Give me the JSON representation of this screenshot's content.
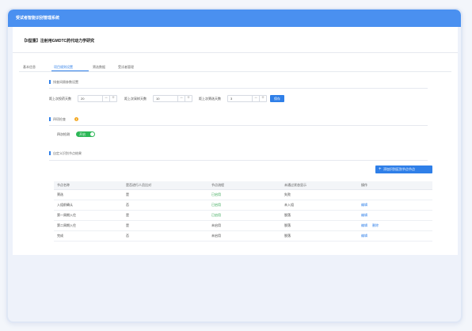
{
  "app": {
    "title": "受试者智能识别管理系统"
  },
  "project": {
    "title": "【II型重】注射用GMDTC药代动力学研究"
  },
  "tabs": [
    {
      "label": "基本信息",
      "active": false
    },
    {
      "label": "项目规则设置",
      "active": true
    },
    {
      "label": "筛选数据",
      "active": false
    },
    {
      "label": "受试者管理",
      "active": false
    }
  ],
  "sections": {
    "interval": {
      "title": "排查间隔参数设置",
      "fields": [
        {
          "label": "距上次投药天数",
          "value": "20"
        },
        {
          "label": "距上次采样天数",
          "value": "10"
        },
        {
          "label": "距上次筛选天数",
          "value": "3"
        }
      ],
      "save_label": "保存"
    },
    "check": {
      "title": "四项检查",
      "field_label": "四次检测",
      "toggle_label": "开启",
      "toggle_on": true
    },
    "flow": {
      "title": "自定义识别节点结果",
      "add_label": "添加识别区别节点节点"
    }
  },
  "table": {
    "headers": [
      "节点名称",
      "是否进行人员比对",
      "节点流程",
      "未通过状态显示",
      "操作"
    ],
    "rows": [
      {
        "name": "筛选",
        "compare": "是",
        "status": "已启用",
        "status_done": true,
        "fail": "失败",
        "actions": []
      },
      {
        "name": "入组前确认",
        "compare": "否",
        "status": "已启用",
        "status_done": true,
        "fail": "未入组",
        "actions": [
          "编辑"
        ]
      },
      {
        "name": "第一周期入住",
        "compare": "是",
        "status": "已启用",
        "status_done": true,
        "fail": "脱落",
        "actions": [
          "编辑"
        ]
      },
      {
        "name": "第二周期入住",
        "compare": "是",
        "status": "未启用",
        "status_done": false,
        "fail": "脱落",
        "actions": [
          "编辑",
          "删除"
        ]
      },
      {
        "name": "完成",
        "compare": "否",
        "status": "未启用",
        "status_done": false,
        "fail": "脱落",
        "actions": [
          "编辑"
        ]
      }
    ]
  },
  "colors": {
    "primary": "#2f7fe8",
    "header_bg": "#4a90f0",
    "success": "#2db757",
    "warning": "#f3a925"
  },
  "icons": {
    "warning": "exclamation-icon",
    "add": "plus-icon",
    "stepper_minus": "minus-icon",
    "stepper_plus": "plus-icon"
  }
}
